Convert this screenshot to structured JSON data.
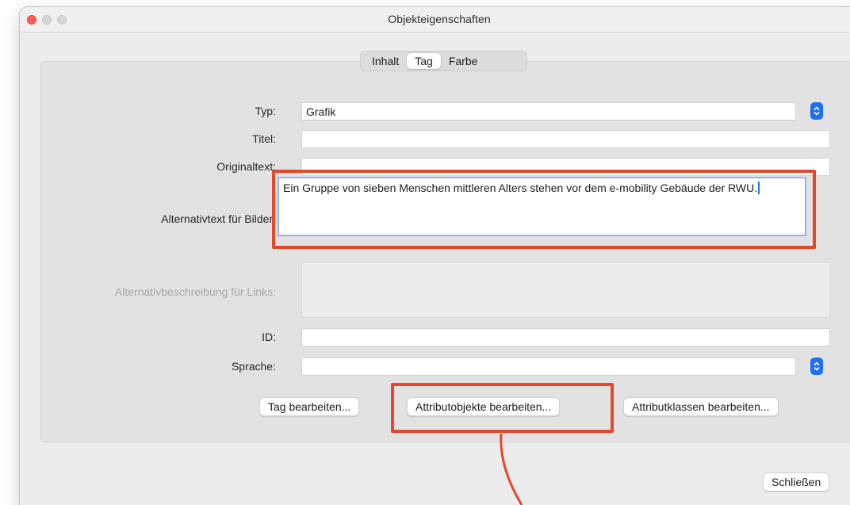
{
  "window": {
    "title": "Objekteigenschaften"
  },
  "tabs": [
    {
      "label": "Inhalt",
      "active": false
    },
    {
      "label": "Tag",
      "active": true
    },
    {
      "label": "Farbe",
      "active": false
    }
  ],
  "form": {
    "typ": {
      "label": "Typ:",
      "value": "Grafik"
    },
    "titel": {
      "label": "Titel:",
      "value": ""
    },
    "originaltext": {
      "label": "Originaltext:",
      "value": ""
    },
    "alternativtext": {
      "label": "Alternativtext für Bilder:",
      "value": "Ein Gruppe von sieben Menschen mittleren Alters stehen vor dem e-mobility Gebäude der RWU."
    },
    "alternativbeschreibung": {
      "label": "Alternativbeschreibung für Links:",
      "value": ""
    },
    "id": {
      "label": "ID:",
      "value": ""
    },
    "sprache": {
      "label": "Sprache:",
      "value": ""
    }
  },
  "buttons": {
    "tag_bearbeiten": "Tag bearbeiten...",
    "attributobjekte_bearbeiten": "Attributobjekte bearbeiten...",
    "attributklassen_bearbeiten": "Attributklassen bearbeiten...",
    "schliessen": "Schließen"
  },
  "icons": {
    "stepper": "up-down-chevron-icon"
  },
  "colors": {
    "highlight": "#e6472a",
    "accent": "#1e6ff5"
  }
}
